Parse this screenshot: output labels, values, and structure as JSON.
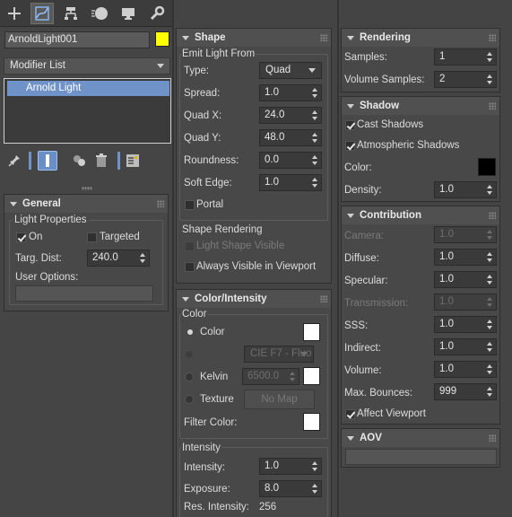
{
  "toolbar": {
    "tabs": [
      "create",
      "modify",
      "hierarchy",
      "motion",
      "display",
      "utilities"
    ],
    "active": "modify"
  },
  "object": {
    "name": "ArnoldLight001",
    "color": "#ffff00"
  },
  "modifier": {
    "list_label": "Modifier List",
    "stack": [
      "Arnold Light"
    ]
  },
  "general": {
    "title": "General",
    "group": "Light Properties",
    "on_label": "On",
    "on": true,
    "targeted_label": "Targeted",
    "targeted": false,
    "targ_dist_label": "Targ. Dist:",
    "targ_dist": "240.0",
    "user_options_label": "User Options:",
    "user_options": ""
  },
  "shape": {
    "title": "Shape",
    "emit_group": "Emit Light From",
    "type_label": "Type:",
    "type": "Quad",
    "spread_label": "Spread:",
    "spread": "1.0",
    "quadx_label": "Quad X:",
    "quadx": "24.0",
    "quady_label": "Quad Y:",
    "quady": "48.0",
    "roundness_label": "Roundness:",
    "roundness": "0.0",
    "softedge_label": "Soft Edge:",
    "softedge": "1.0",
    "portal_label": "Portal",
    "portal": false,
    "render_group": "Shape Rendering",
    "light_shape_visible_label": "Light Shape Visible",
    "always_visible_label": "Always Visible in Viewport"
  },
  "color": {
    "title": "Color/Intensity",
    "group": "Color",
    "color_label": "Color",
    "preset": "CIE F7 - Fluo",
    "kelvin_label": "Kelvin",
    "kelvin": "6500.0",
    "texture_label": "Texture",
    "no_map": "No Map",
    "filter_label": "Filter Color:",
    "swatch": "#ffffff"
  },
  "intensity": {
    "group": "Intensity",
    "intensity_label": "Intensity:",
    "intensity": "1.0",
    "exposure_label": "Exposure:",
    "exposure": "8.0",
    "res_label": "Res. Intensity:",
    "res": "256"
  },
  "rendering": {
    "title": "Rendering",
    "samples_label": "Samples:",
    "samples": "1",
    "volume_label": "Volume Samples:",
    "volume": "2"
  },
  "shadow": {
    "title": "Shadow",
    "cast_label": "Cast Shadows",
    "cast": true,
    "atmo_label": "Atmospheric Shadows",
    "atmo": true,
    "color_label": "Color:",
    "color": "#000000",
    "density_label": "Density:",
    "density": "1.0"
  },
  "contribution": {
    "title": "Contribution",
    "camera_label": "Camera:",
    "camera": "1.0",
    "diffuse_label": "Diffuse:",
    "diffuse": "1.0",
    "specular_label": "Specular:",
    "specular": "1.0",
    "transmission_label": "Transmission:",
    "transmission": "1.0",
    "sss_label": "SSS:",
    "sss": "1.0",
    "indirect_label": "Indirect:",
    "indirect": "1.0",
    "volume_label": "Volume:",
    "volume": "1.0",
    "bounces_label": "Max. Bounces:",
    "bounces": "999",
    "affect_label": "Affect Viewport",
    "affect": true
  },
  "aov": {
    "title": "AOV",
    "value": ""
  }
}
